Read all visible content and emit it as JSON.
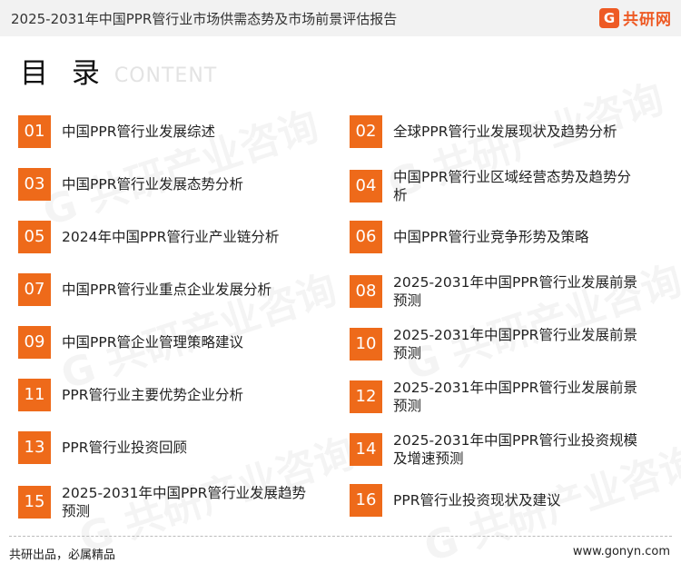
{
  "header": {
    "title": "2025-2031年中国PPR管行业市场供需态势及市场前景评估报告",
    "logo_text": "共研网",
    "logo_mark": "G"
  },
  "heading": {
    "cn": "目 录",
    "en": "CONTENT"
  },
  "toc": [
    {
      "num": "01",
      "label": "中国PPR管行业发展综述"
    },
    {
      "num": "02",
      "label": "全球PPR管行业发展现状及趋势分析"
    },
    {
      "num": "03",
      "label": "中国PPR管行业发展态势分析"
    },
    {
      "num": "04",
      "label": "中国PPR管行业区域经营态势及趋势分析"
    },
    {
      "num": "05",
      "label": "2024年中国PPR管行业产业链分析"
    },
    {
      "num": "06",
      "label": "中国PPR管行业竞争形势及策略"
    },
    {
      "num": "07",
      "label": "中国PPR管行业重点企业发展分析"
    },
    {
      "num": "08",
      "label": "2025-2031年中国PPR管行业发展前景预测"
    },
    {
      "num": "09",
      "label": "中国PPR管企业管理策略建议"
    },
    {
      "num": "10",
      "label": "2025-2031年中国PPR管行业发展前景预测"
    },
    {
      "num": "11",
      "label": "PPR管行业主要优势企业分析"
    },
    {
      "num": "12",
      "label": "2025-2031年中国PPR管行业发展前景预测"
    },
    {
      "num": "13",
      "label": "PPR管行业投资回顾"
    },
    {
      "num": "14",
      "label": "2025-2031年中国PPR管行业投资规模及增速预测"
    },
    {
      "num": "15",
      "label": "2025-2031年中国PPR管行业发展趋势预测"
    },
    {
      "num": "16",
      "label": "PPR管行业投资现状及建议"
    }
  ],
  "footer": {
    "slogan": "共研出品，必属精品",
    "url": "www.gonyn.com"
  },
  "colors": {
    "accent": "#ee6a1a",
    "logo": "#ee5a24"
  }
}
